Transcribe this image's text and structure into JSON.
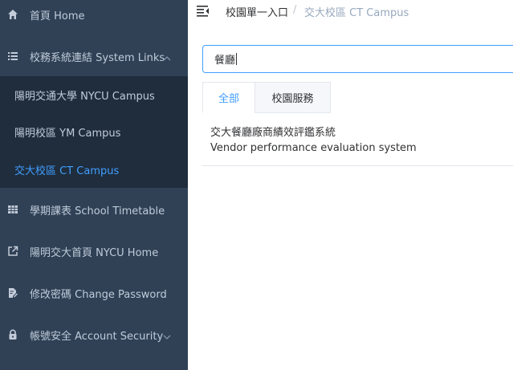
{
  "sidebar": {
    "home": {
      "label": "首頁 Home",
      "icon": "home-icon"
    },
    "system_links": {
      "label": "校務系統連結 System Links",
      "icon": "list-icon",
      "chevron": "chevron-up-icon"
    },
    "subitems": [
      {
        "label": "陽明交通大學 NYCU Campus"
      },
      {
        "label": "陽明校區 YM Campus"
      },
      {
        "label": "交大校區 CT Campus",
        "active": true
      }
    ],
    "timetable": {
      "label": "學期課表 School Timetable",
      "icon": "grid-icon"
    },
    "nycu_home": {
      "label": "陽明交大首頁 NYCU Home",
      "icon": "external-link-icon"
    },
    "change_password": {
      "label": "修改密碼 Change Password",
      "icon": "edit-icon"
    },
    "account_security": {
      "label": "帳號安全 Account Security",
      "icon": "lock-icon",
      "chevron": "chevron-down-icon"
    }
  },
  "navbar": {
    "breadcrumb": [
      "校園單一入口",
      "交大校區 CT Campus"
    ],
    "separator": "/"
  },
  "search": {
    "value": "餐廳"
  },
  "tabs": [
    {
      "label": "全部",
      "active": true
    },
    {
      "label": "校園服務",
      "active": false
    }
  ],
  "results": [
    {
      "title_zh": "交大餐廳廠商績效評鑑系統",
      "title_en": "Vendor performance evaluation system"
    }
  ],
  "colors": {
    "sidebar_bg": "#304156",
    "submenu_bg": "#1f2d3d",
    "accent": "#409eff",
    "text": "#303133"
  }
}
